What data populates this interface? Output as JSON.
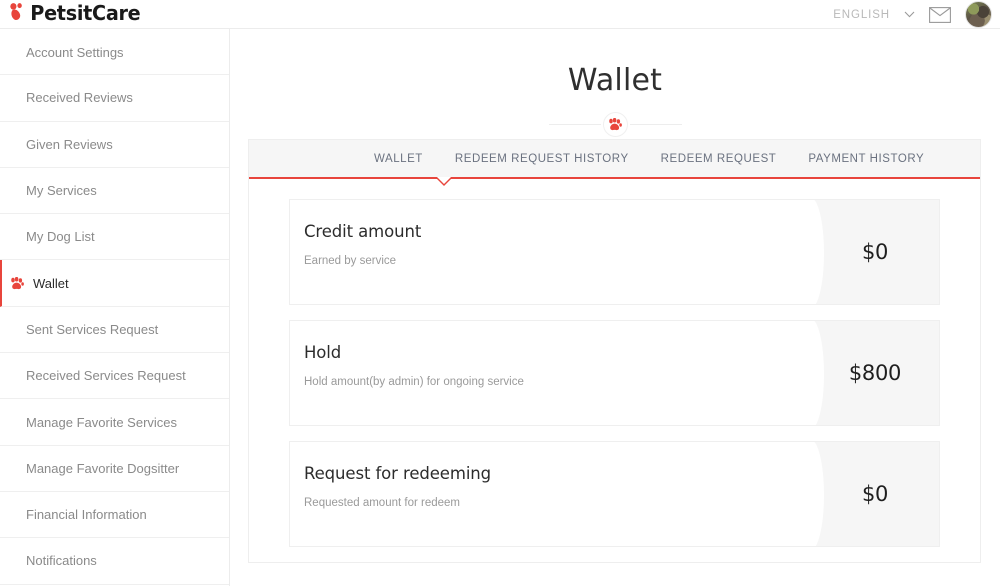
{
  "brand": {
    "name": "PetsitCare",
    "logo_icon": "paw-heart-icon",
    "accent_color": "#e8453c"
  },
  "topbar": {
    "language": "ENGLISH",
    "language_chevron_icon": "chevron-down-icon",
    "mail_icon": "envelope-icon",
    "avatar_icon": "user-avatar"
  },
  "sidebar": {
    "items": [
      {
        "label": "Account Settings",
        "active": false
      },
      {
        "label": "Received Reviews",
        "active": false
      },
      {
        "label": "Given Reviews",
        "active": false
      },
      {
        "label": "My Services",
        "active": false
      },
      {
        "label": "My Dog List",
        "active": false
      },
      {
        "label": "Wallet",
        "active": true,
        "icon": "paw-icon"
      },
      {
        "label": "Sent Services Request",
        "active": false
      },
      {
        "label": "Received Services Request",
        "active": false
      },
      {
        "label": "Manage Favorite Services",
        "active": false
      },
      {
        "label": "Manage Favorite Dogsitter",
        "active": false
      },
      {
        "label": "Financial Information",
        "active": false
      },
      {
        "label": "Notifications",
        "active": false
      }
    ]
  },
  "main": {
    "title": "Wallet",
    "divider_icon": "paw-icon",
    "tabs": [
      {
        "label": "WALLET",
        "active": true
      },
      {
        "label": "REDEEM REQUEST HISTORY",
        "active": false
      },
      {
        "label": "REDEEM REQUEST",
        "active": false
      },
      {
        "label": "PAYMENT HISTORY",
        "active": false
      }
    ],
    "cards": [
      {
        "title": "Credit amount",
        "subtitle": "Earned by service",
        "amount": "$0"
      },
      {
        "title": "Hold",
        "subtitle": "Hold amount(by admin) for ongoing service",
        "amount": "$800"
      },
      {
        "title": "Request for redeeming",
        "subtitle": "Requested amount for redeem",
        "amount": "$0"
      }
    ]
  }
}
